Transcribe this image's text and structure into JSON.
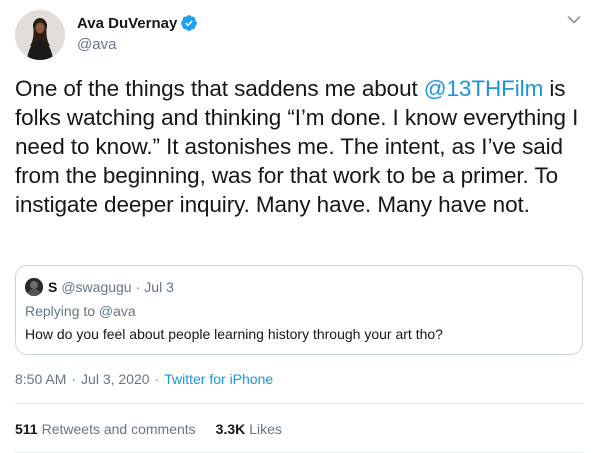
{
  "author": {
    "name": "Ava DuVernay",
    "handle": "@ava",
    "verified": true,
    "avatar_icon": "person-avatar"
  },
  "tweet": {
    "text_before_mention": "One of the things that saddens me about ",
    "mention": "@13THFilm",
    "text_after_mention": " is folks watching and thinking “I’m done. I know everything I need to know.” It astonishes me. The intent, as I’ve said from the beginning, was for that work to be a primer. To instigate deeper inquiry. Many have. Many have not."
  },
  "quoted": {
    "name": "S",
    "handle": "@swagugu",
    "separator": "·",
    "date": "Jul 3",
    "replying_to": "Replying to @ava",
    "text": "How do you feel about people learning history through your art tho?"
  },
  "meta": {
    "time": "8:50 AM",
    "separator1": "·",
    "date": "Jul 3, 2020",
    "separator2": "·",
    "source": "Twitter for iPhone"
  },
  "stats": {
    "retweets_count": "511",
    "retweets_label": "Retweets and comments",
    "likes_count": "3.3K",
    "likes_label": "Likes"
  },
  "colors": {
    "link": "#1b95e0",
    "secondary_text": "#657786",
    "verified": "#1da1f2",
    "border": "#ccd6dd"
  }
}
